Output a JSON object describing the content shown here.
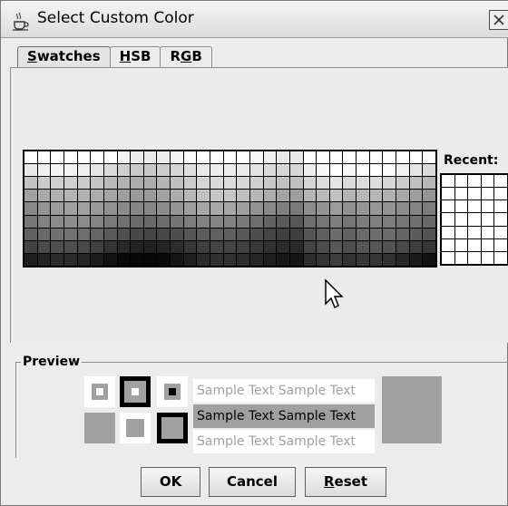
{
  "window": {
    "title": "Select Custom Color",
    "icon": "java-cup-icon"
  },
  "tabs": [
    {
      "label": "Swatches",
      "mnemonic": "S",
      "selected": true
    },
    {
      "label": "HSB",
      "mnemonic": "H",
      "selected": false
    },
    {
      "label": "RGB",
      "mnemonic": "G",
      "selected": false
    }
  ],
  "swatches": {
    "recent_label": "Recent:"
  },
  "preview": {
    "label": "Preview",
    "sample_text": "Sample Text",
    "preview_color": "#a0a0a0"
  },
  "buttons": {
    "ok": "OK",
    "cancel": "Cancel",
    "reset": "Reset"
  }
}
